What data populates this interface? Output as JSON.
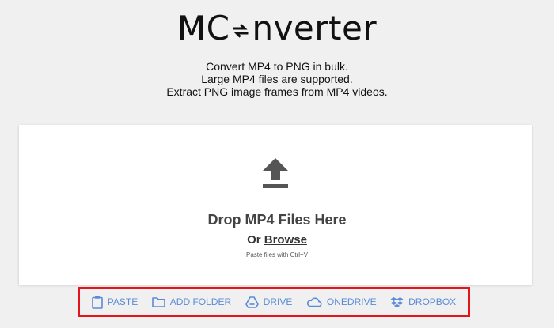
{
  "logo": {
    "prefix": "MC",
    "suffix": "nverter"
  },
  "tagline": [
    "Convert MP4 to PNG in bulk.",
    "Large MP4 files are supported.",
    "Extract PNG image frames from MP4 videos."
  ],
  "dropzone": {
    "title": "Drop MP4 Files Here",
    "or_text": "Or",
    "browse_label": "Browse",
    "paste_hint": "Paste files with Ctrl+V"
  },
  "toolbar": {
    "paste": "PASTE",
    "add_folder": "ADD FOLDER",
    "drive": "DRIVE",
    "onedrive": "ONEDRIVE",
    "dropbox": "DROPBOX"
  },
  "colors": {
    "accent": "#5a8ad8",
    "highlight_border": "#e3141b",
    "icon_gray": "#555555"
  },
  "icons": {
    "logo_mark": "swap-arrows-icon",
    "upload": "upload-icon",
    "paste": "clipboard-icon",
    "add_folder": "folder-icon",
    "drive": "google-drive-icon",
    "onedrive": "onedrive-icon",
    "dropbox": "dropbox-icon"
  }
}
